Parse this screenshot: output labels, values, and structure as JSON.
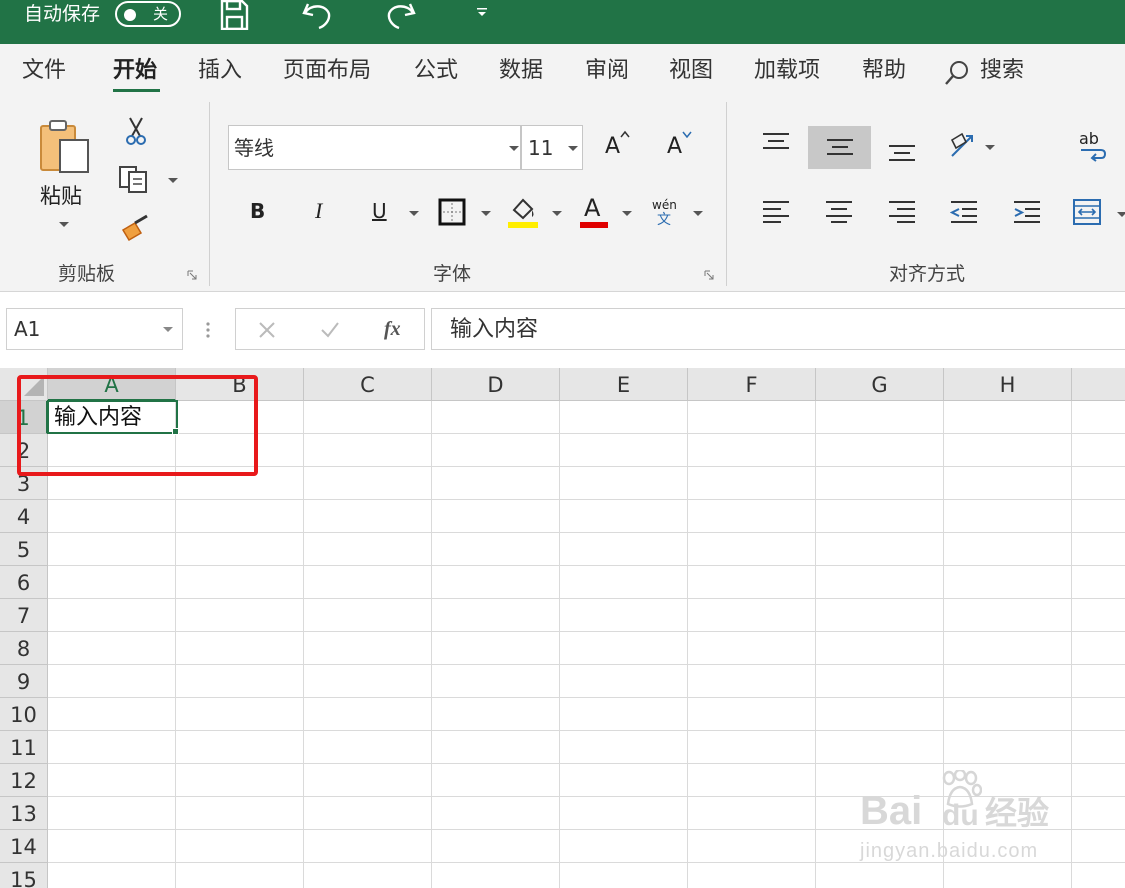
{
  "titlebar": {
    "autosave_label": "自动保存",
    "toggle_state": "关"
  },
  "menu": {
    "tabs": [
      "文件",
      "开始",
      "插入",
      "页面布局",
      "公式",
      "数据",
      "审阅",
      "视图",
      "加载项",
      "帮助"
    ],
    "active_tab": "开始",
    "search_label": "搜索"
  },
  "ribbon": {
    "clipboard": {
      "paste_label": "粘贴",
      "group_label": "剪贴板"
    },
    "font": {
      "font_name": "等线",
      "font_size": "11",
      "bold": "B",
      "italic": "I",
      "underline": "U",
      "grow": "A",
      "shrink": "A",
      "font_color_glyph": "A",
      "phonetic_top": "wén",
      "phonetic_bottom": "文",
      "group_label": "字体",
      "highlight_color": "#ffee00",
      "font_color": "#e00000"
    },
    "alignment": {
      "wrap_glyph": "ab",
      "group_label": "对齐方式"
    }
  },
  "formula_bar": {
    "name_box": "A1",
    "fx_label": "fx",
    "content": "输入内容"
  },
  "sheet": {
    "columns": [
      "A",
      "B",
      "C",
      "D",
      "E",
      "F",
      "G",
      "H"
    ],
    "rows": [
      "1",
      "2",
      "3",
      "4",
      "5",
      "6",
      "7",
      "8",
      "9",
      "10",
      "11",
      "12",
      "13",
      "14",
      "15"
    ],
    "selected_cell": "A1",
    "cells": {
      "A1": "输入内容"
    }
  },
  "colors": {
    "accent": "#217346",
    "annotation": "#e8191b"
  },
  "watermark": {
    "brand": "Bai",
    "brand2": "du",
    "cn": "经验",
    "url": "jingyan.baidu.com"
  }
}
